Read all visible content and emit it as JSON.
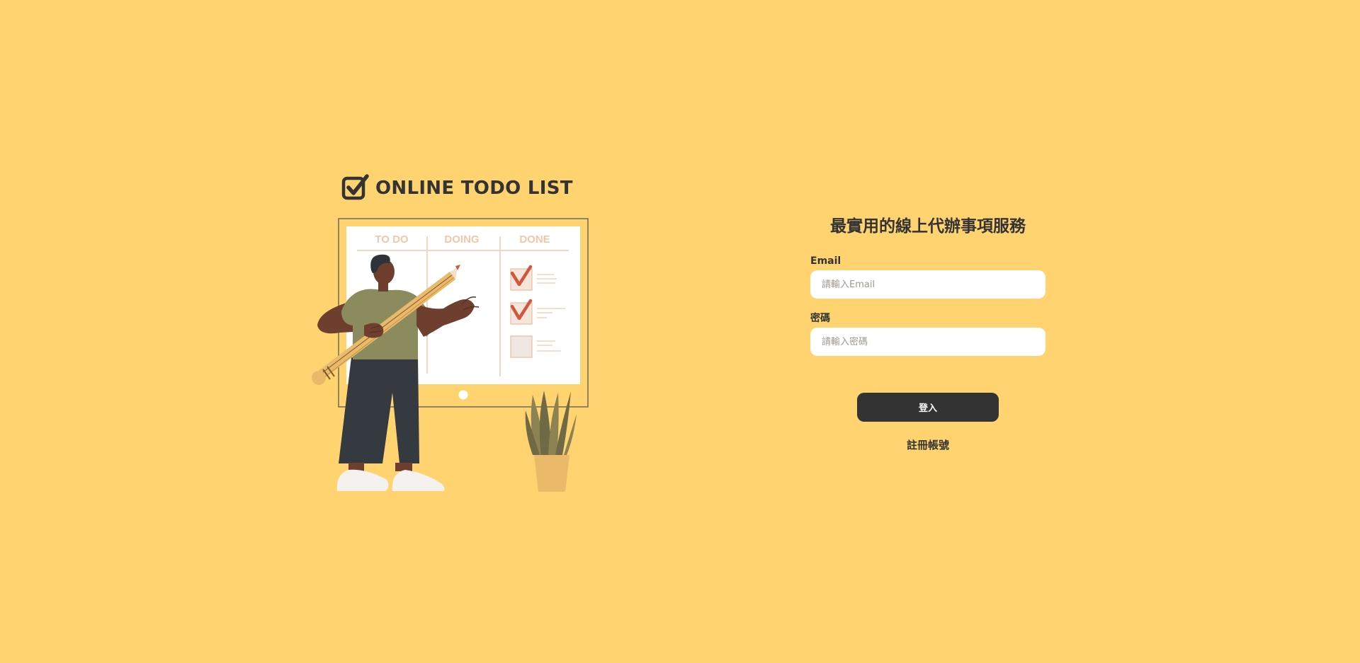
{
  "brand": {
    "logo_text": "ONLINE TODO LIST",
    "logo_icon": "checkbox-check-icon"
  },
  "illustration": {
    "columns": [
      "TO DO",
      "DOING",
      "DONE"
    ]
  },
  "form": {
    "tagline": "最實用的線上代辦事項服務",
    "email_label": "Email",
    "email_placeholder": "請輸入Email",
    "password_label": "密碼",
    "password_placeholder": "請輸入密碼",
    "login_label": "登入",
    "register_label": "註冊帳號"
  },
  "colors": {
    "background": "#FFD370",
    "primary_dark": "#333333",
    "input_bg": "#FFFFFF",
    "accent_check": "#D87355"
  }
}
